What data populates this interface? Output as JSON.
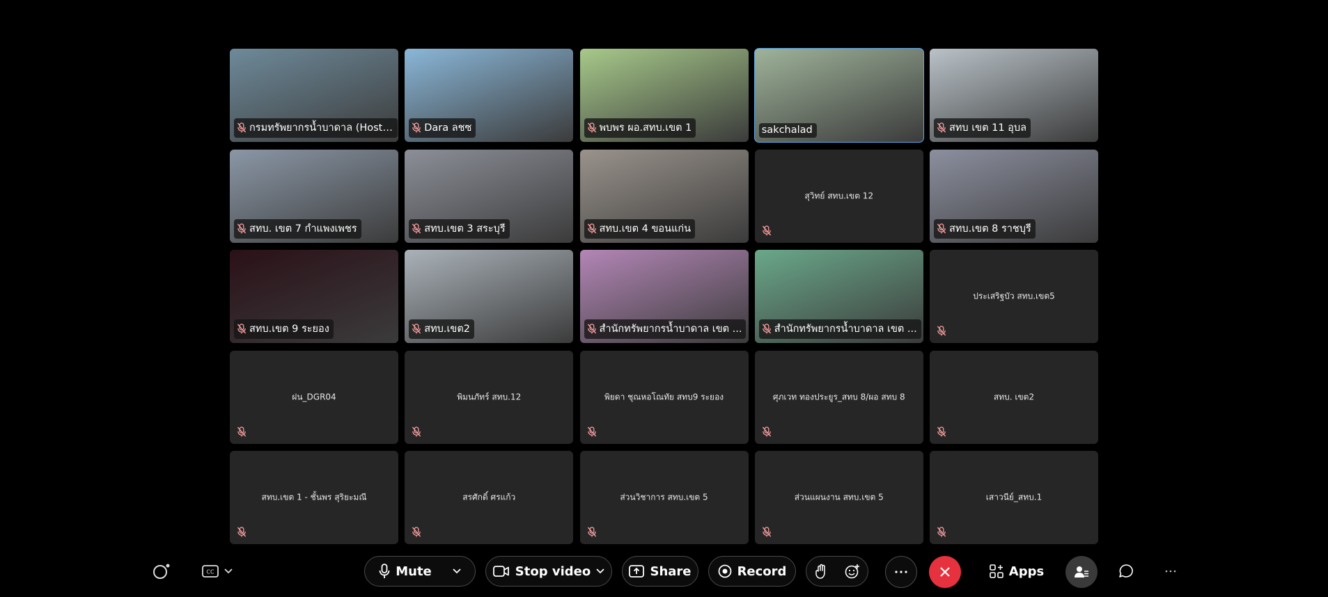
{
  "participants": [
    {
      "name": "กรมทรัพยากรน้ำบาดาล (Host...)",
      "video": true,
      "bg": "#6e8a9a"
    },
    {
      "name": "Dara ลชซ",
      "video": true,
      "bg": "#8ab7d8"
    },
    {
      "name": "พบพร ผอ.สทบ.เขต 1",
      "video": true,
      "bg": "#a7c98a"
    },
    {
      "name": "sakchalad",
      "video": true,
      "bg": "#9fb39a"
    },
    {
      "name": "สทบ เขต 11 อุบล",
      "video": true,
      "bg": "#b9c2c8"
    },
    {
      "name": "สทบ. เขต 7 กำแพงเพชร",
      "video": true,
      "bg": "#8b97a6"
    },
    {
      "name": "สทบ.เขต 3 สระบุรี",
      "video": true,
      "bg": "#8c8f98"
    },
    {
      "name": "สทบ.เขต 4 ขอนแก่น",
      "video": true,
      "bg": "#9a938c"
    },
    {
      "name": "สุวิทย์ สทบ.เขต 12",
      "video": false
    },
    {
      "name": "สทบ.เขต 8 ราชบุรี",
      "video": true,
      "bg": "#8c8f9f"
    },
    {
      "name": "สทบ.เขต 9 ระยอง",
      "video": true,
      "bg": "#2a1118"
    },
    {
      "name": "สทบ.เขต2",
      "video": true,
      "bg": "#aab2b9"
    },
    {
      "name": "สำนักทรัพยากรน้ำบาดาล เขต ...",
      "video": true,
      "bg": "#b386b6"
    },
    {
      "name": "สำนักทรัพยากรน้ำบาดาล เขต ...",
      "video": true,
      "bg": "#6aa88a"
    },
    {
      "name": "ประเสริฐบัว สทบ.เขต5",
      "video": false
    },
    {
      "name": "ฝน_DGR04",
      "video": false
    },
    {
      "name": "พิมนภัทร์ สทบ.12",
      "video": false
    },
    {
      "name": "พิยดา ชุณหอโณทัย สทบ9 ระยอง",
      "video": false
    },
    {
      "name": "ศุภเวท ทองประยูร_สทบ 8/ผอ สทบ 8",
      "video": false
    },
    {
      "name": "สทบ. เขต2",
      "video": false
    },
    {
      "name": "สทบ.เขต 1 - ชั้นพร สุริยะมณี",
      "video": false
    },
    {
      "name": "สรศักดิ์ ศรแก้ว",
      "video": false
    },
    {
      "name": "ส่วนวิชาการ สทบ.เขต 5",
      "video": false
    },
    {
      "name": "ส่วนแผนงาน สทบ.เขต 5",
      "video": false
    },
    {
      "name": "เสาวนีย์_สทบ.1",
      "video": false
    }
  ],
  "toolbar": {
    "mute_label": "Mute",
    "stop_video_label": "Stop video",
    "share_label": "Share",
    "record_label": "Record",
    "apps_label": "Apps",
    "end_color": "#e6323e"
  }
}
